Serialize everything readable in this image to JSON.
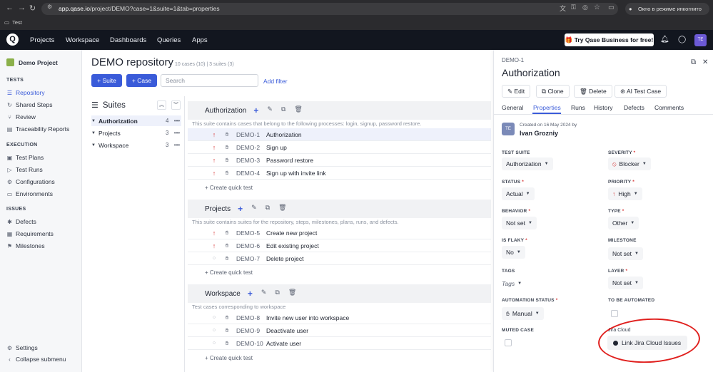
{
  "browser": {
    "url_domain": "app.qase.io",
    "url_path": "/project/DEMO?case=1&suite=1&tab=properties",
    "bookmark": "Test",
    "incognito_label": "Окно в режиме инкогнито"
  },
  "topnav": {
    "logo": "Q",
    "links": [
      "Projects",
      "Workspace",
      "Dashboards",
      "Queries",
      "Apps"
    ],
    "promo": "🎁 Try Qase Business for free!",
    "avatar": "TE"
  },
  "sidebar": {
    "project_name": "Demo Project",
    "sections": {
      "tests": "TESTS",
      "execution": "EXECUTION",
      "issues": "ISSUES"
    },
    "tests_items": [
      "Repository",
      "Shared Steps",
      "Review",
      "Traceability Reports"
    ],
    "execution_items": [
      "Test Plans",
      "Test Runs",
      "Configurations",
      "Environments"
    ],
    "issues_items": [
      "Defects",
      "Requirements",
      "Milestones"
    ],
    "settings": "Settings",
    "collapse": "Collapse submenu"
  },
  "main": {
    "title": "DEMO repository",
    "subtitle": "10 cases (10) | 3 suites (3)",
    "add_suite": "+ Suite",
    "add_case": "+ Case",
    "search_placeholder": "Search",
    "add_filter": "Add filter"
  },
  "suites_panel": {
    "heading": "Suites",
    "tree": [
      {
        "name": "Authorization",
        "count": "4"
      },
      {
        "name": "Projects",
        "count": "3"
      },
      {
        "name": "Workspace",
        "count": "3"
      }
    ]
  },
  "suites": [
    {
      "name": "Authorization",
      "desc": "This suite contains cases that belong to the following processes: login, signup, password restore.",
      "cases": [
        {
          "id": "DEMO-1",
          "title": "Authorization",
          "priority": "high"
        },
        {
          "id": "DEMO-2",
          "title": "Sign up",
          "priority": "high"
        },
        {
          "id": "DEMO-3",
          "title": "Password restore",
          "priority": "high"
        },
        {
          "id": "DEMO-4",
          "title": "Sign up with invite link",
          "priority": "high"
        }
      ]
    },
    {
      "name": "Projects",
      "desc": "This suite contains suites for the repository, steps, milestones, plans, runs, and defects.",
      "cases": [
        {
          "id": "DEMO-5",
          "title": "Create new project",
          "priority": "high"
        },
        {
          "id": "DEMO-6",
          "title": "Edit existing project",
          "priority": "high"
        },
        {
          "id": "DEMO-7",
          "title": "Delete project",
          "priority": "none"
        }
      ]
    },
    {
      "name": "Workspace",
      "desc": "Test cases corresponding to workspace",
      "cases": [
        {
          "id": "DEMO-8",
          "title": "Invite new user into workspace",
          "priority": "none"
        },
        {
          "id": "DEMO-9",
          "title": "Deactivate user",
          "priority": "none"
        },
        {
          "id": "DEMO-10",
          "title": "Activate user",
          "priority": "none"
        }
      ]
    }
  ],
  "quick_test": "+ Create quick test",
  "panel": {
    "case_id": "DEMO-1",
    "title": "Authorization",
    "buttons": [
      "Edit",
      "Clone",
      "Delete",
      "AI Test Case"
    ],
    "tabs": [
      "General",
      "Properties",
      "Runs",
      "History",
      "Defects",
      "Comments"
    ],
    "author_avatar": "TE",
    "created": "Created on 16 May 2024 by",
    "author": "Ivan Grozniy",
    "fields": {
      "test_suite": {
        "label": "TEST SUITE",
        "value": "Authorization"
      },
      "severity": {
        "label": "SEVERITY",
        "value": "Blocker"
      },
      "status": {
        "label": "STATUS",
        "value": "Actual"
      },
      "priority": {
        "label": "PRIORITY",
        "value": "High"
      },
      "behavior": {
        "label": "BEHAVIOR",
        "value": "Not set"
      },
      "type": {
        "label": "TYPE",
        "value": "Other"
      },
      "is_flaky": {
        "label": "IS FLAKY",
        "value": "No"
      },
      "milestone": {
        "label": "MILESTONE",
        "value": "Not set"
      },
      "tags": {
        "label": "TAGS",
        "value": "Tags"
      },
      "layer": {
        "label": "LAYER",
        "value": "Not set"
      },
      "automation_status": {
        "label": "AUTOMATION STATUS",
        "value": "Manual"
      },
      "to_be_automated": {
        "label": "TO BE AUTOMATED"
      },
      "muted_case": {
        "label": "MUTED CASE"
      },
      "jira_cloud": {
        "label": "Jira Cloud"
      }
    },
    "jira_button": "Link Jira Cloud Issues"
  },
  "colors": {
    "accent": "#3a5bd9",
    "priority_high": "#d83a3a",
    "highlight": "#e0201e"
  }
}
